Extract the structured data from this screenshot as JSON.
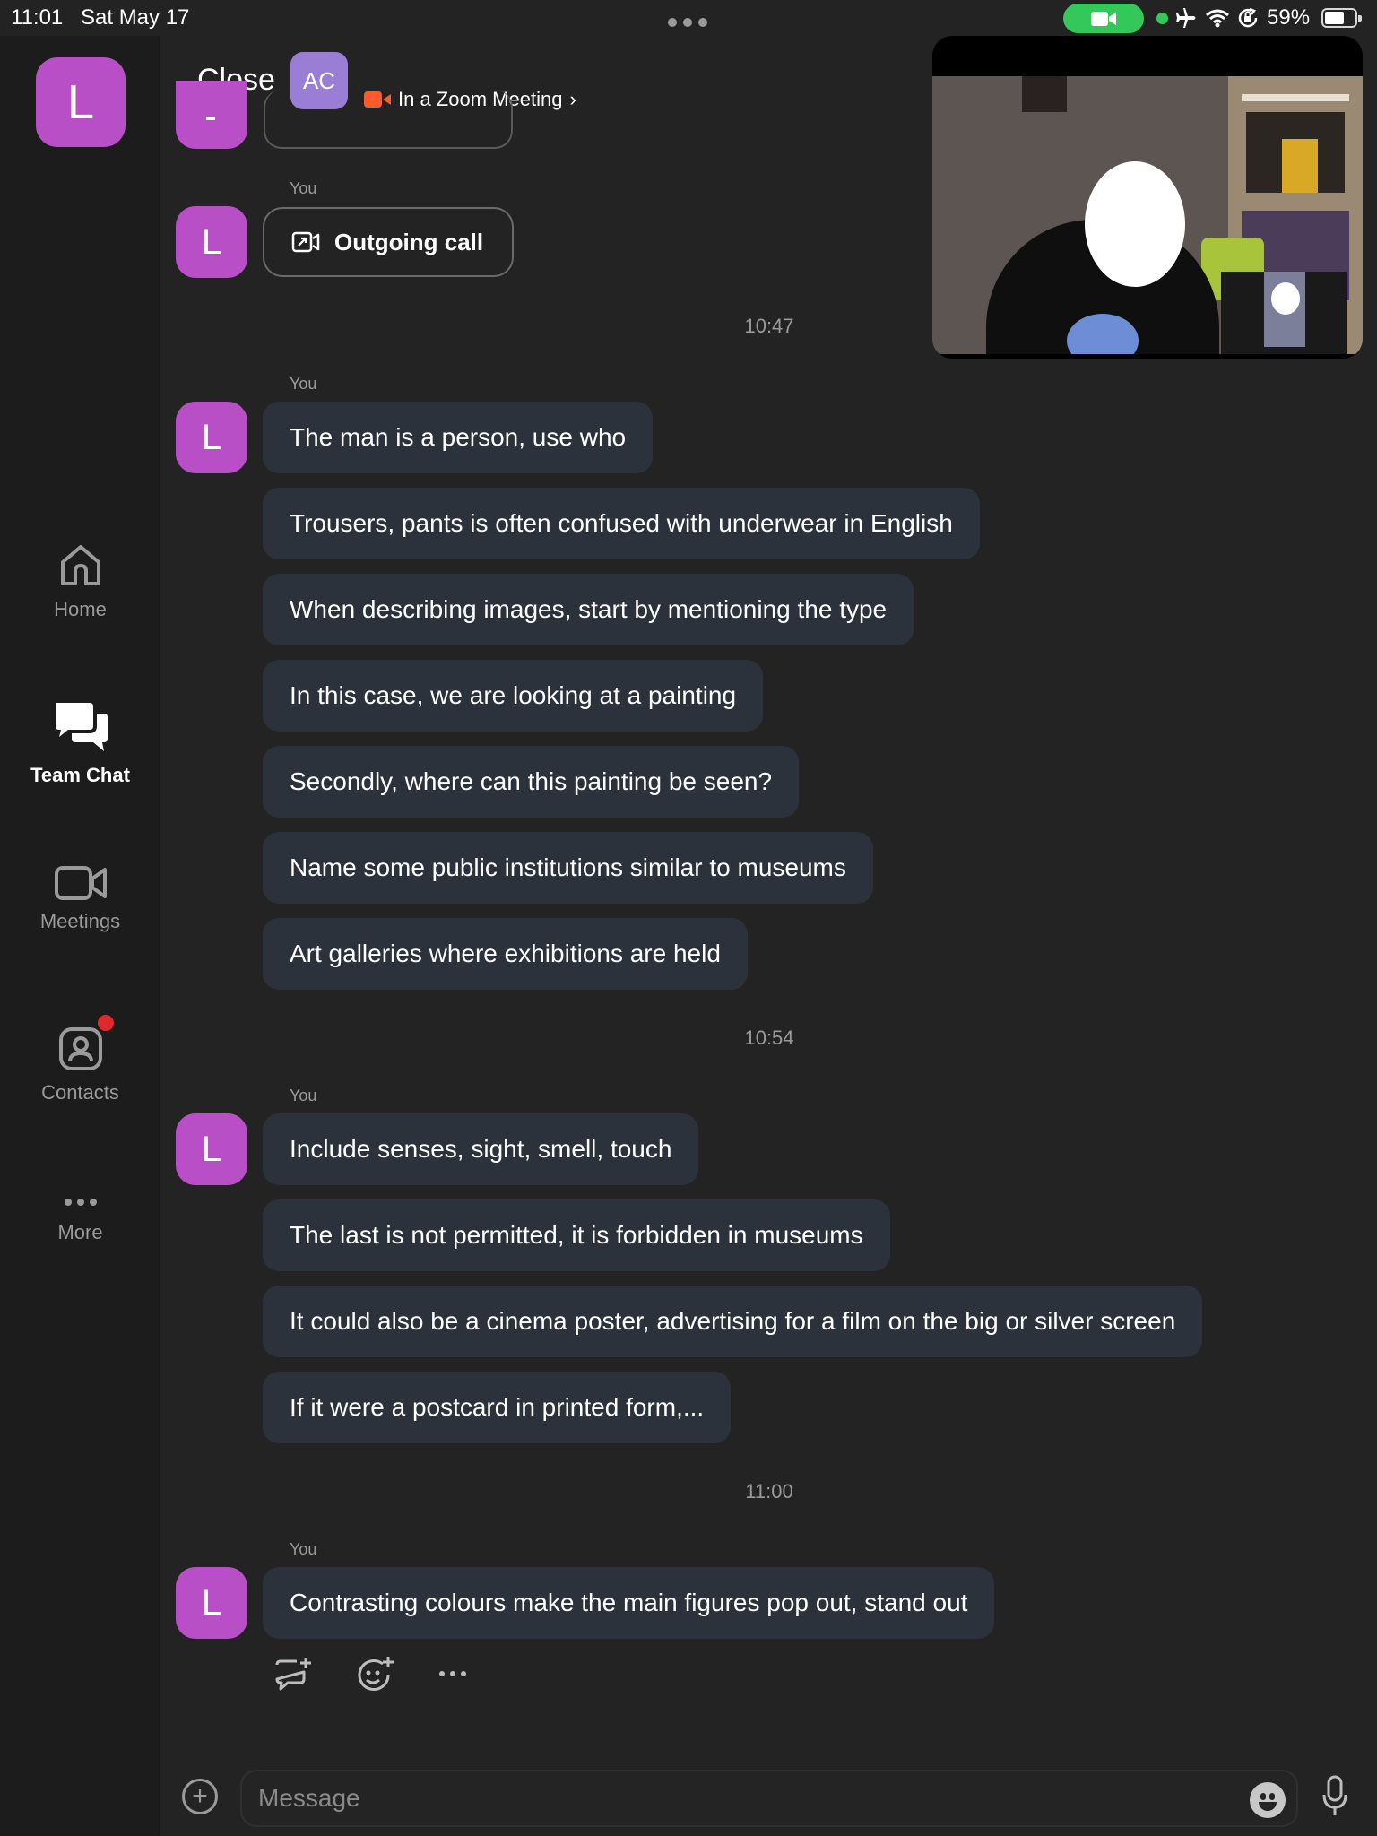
{
  "status_bar": {
    "time": "11:01",
    "date": "Sat May 17",
    "battery": "59%"
  },
  "sidebar": {
    "profile_initial": "L",
    "items": [
      {
        "label": "Home",
        "icon": "home-icon",
        "active": false
      },
      {
        "label": "Team Chat",
        "icon": "chat-bubbles-icon",
        "active": true
      },
      {
        "label": "Meetings",
        "icon": "video-camera-icon",
        "active": false
      },
      {
        "label": "Contacts",
        "icon": "contact-icon",
        "active": false,
        "has_badge": true
      },
      {
        "label": "More",
        "icon": "more-dots-icon",
        "active": false
      }
    ]
  },
  "header": {
    "close_label": "Close",
    "contact_initials": "AC",
    "meeting_status": "In a Zoom Meeting",
    "chevron": "›"
  },
  "chat": {
    "sender_label": "You",
    "avatar_initial": "L",
    "outgoing_call_label": "Outgoing call",
    "timestamps": [
      "10:47",
      "10:54",
      "11:00"
    ],
    "group1": [
      "The man is a person, use who",
      "Trousers, pants is often confused with underwear in English",
      "When describing images, start by mentioning the type",
      "In this case, we are looking at a painting",
      "Secondly, where can this painting be seen?",
      "Name some public institutions similar to museums",
      "Art galleries where exhibitions are held"
    ],
    "group2": [
      "Include senses, sight, smell, touch",
      "The last is not permitted, it is forbidden in museums",
      "It could also be a cinema poster, advertising for a film on the big or silver screen",
      "If it were a postcard in printed form,..."
    ],
    "group3": [
      "Contrasting colours make the main figures pop out, stand out"
    ]
  },
  "composer": {
    "placeholder": "Message"
  },
  "colors": {
    "background": "#232323",
    "sidebar": "#1c1c1c",
    "avatar": "#b94fc7",
    "contact_avatar": "#9a7ed6",
    "bubble": "#2c323b",
    "active_call": "#34c759",
    "zoom_orange": "#ff5b2a",
    "badge_red": "#e0282e"
  }
}
